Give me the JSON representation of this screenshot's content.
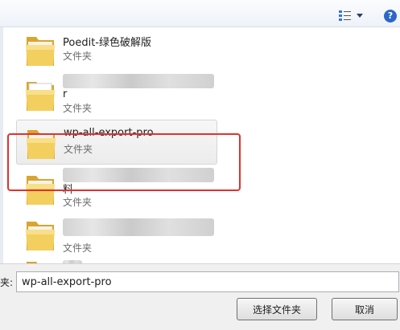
{
  "toolbar": {
    "view_icon": "details-view-icon",
    "help_icon": "help-icon",
    "help_glyph": "?"
  },
  "items": [
    {
      "name": "Poedit-绿色破解版",
      "type": "文件夹"
    },
    {
      "name": "r",
      "type": "文件夹"
    },
    {
      "name": "wp-all-export-pro",
      "type": "文件夹"
    },
    {
      "name": "料",
      "type": "文件夹"
    },
    {
      "name": "",
      "type": "文件夹"
    }
  ],
  "footer": {
    "folder_label": "夹:",
    "folder_value": "wp-all-export-pro",
    "select_button": "选择文件夹",
    "cancel_button": "取消"
  }
}
